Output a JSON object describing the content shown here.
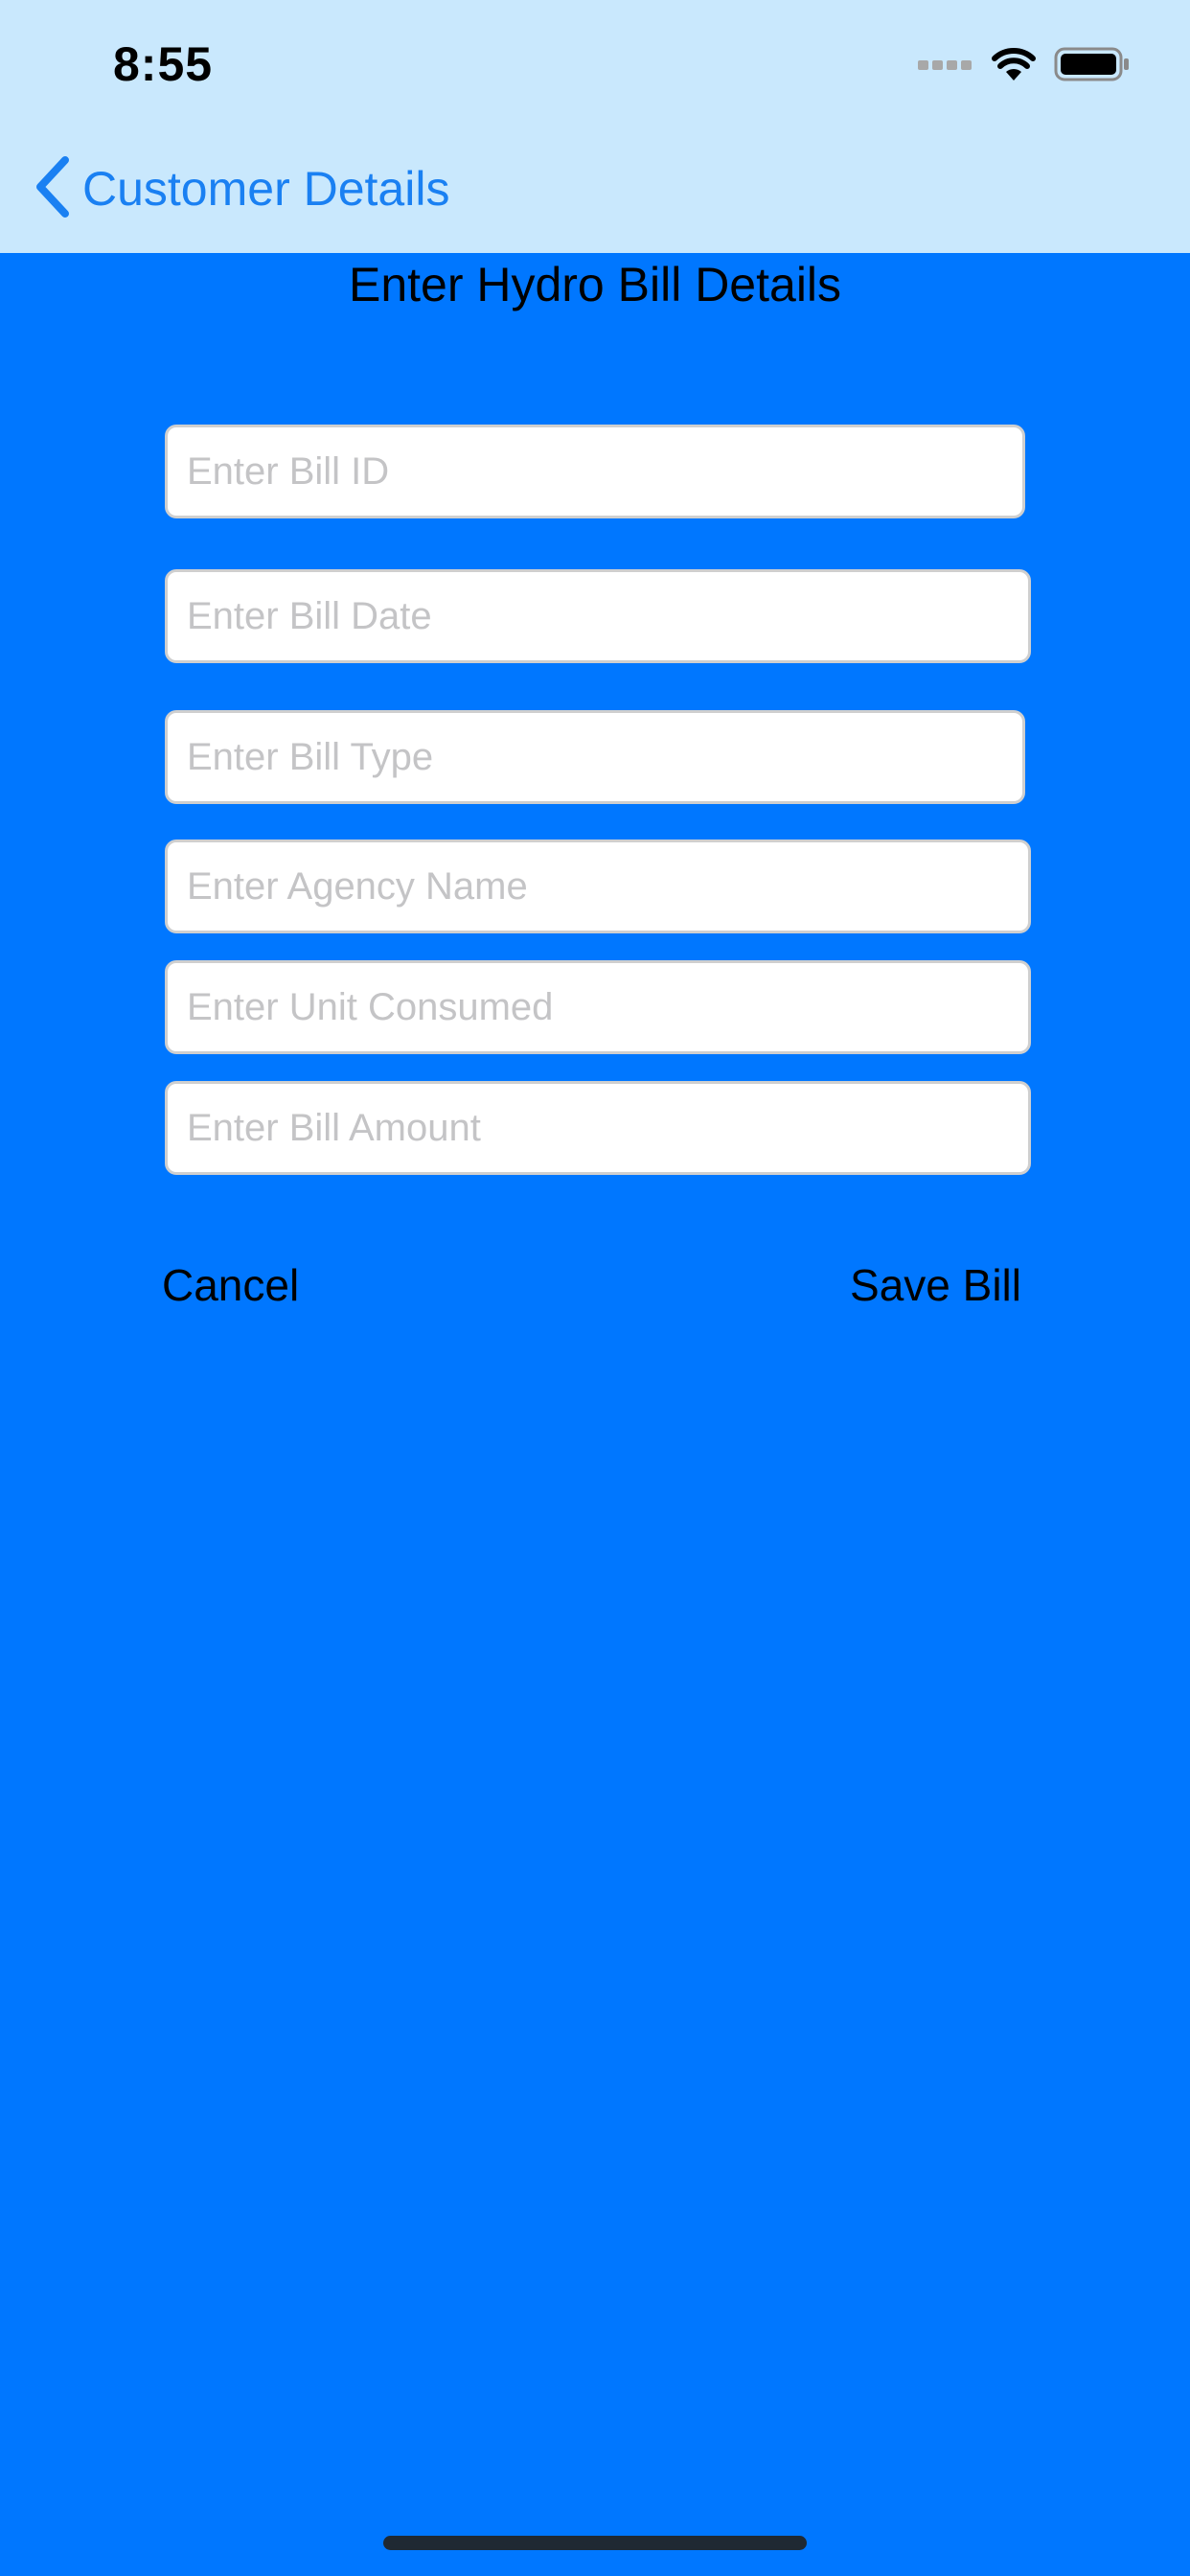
{
  "status_bar": {
    "time": "8:55",
    "icons": [
      "signal-icon",
      "wifi-icon",
      "battery-icon"
    ]
  },
  "nav": {
    "back_label": "Customer Details",
    "back_icon": "chevron-left-icon"
  },
  "form": {
    "title": "Enter Hydro Bill Details",
    "fields": [
      {
        "name": "bill-id-input",
        "placeholder": "Enter Bill ID",
        "value": ""
      },
      {
        "name": "bill-date-input",
        "placeholder": "Enter Bill Date",
        "value": ""
      },
      {
        "name": "bill-type-input",
        "placeholder": "Enter Bill Type",
        "value": ""
      },
      {
        "name": "agency-name-input",
        "placeholder": "Enter Agency Name",
        "value": ""
      },
      {
        "name": "unit-consumed-input",
        "placeholder": "Enter Unit Consumed",
        "value": ""
      },
      {
        "name": "bill-amount-input",
        "placeholder": "Enter Bill Amount",
        "value": ""
      }
    ],
    "cancel_label": "Cancel",
    "save_label": "Save Bill"
  },
  "colors": {
    "background": "#0077ff",
    "bar_background": "#c9e8fd",
    "link": "#1a80f2"
  }
}
